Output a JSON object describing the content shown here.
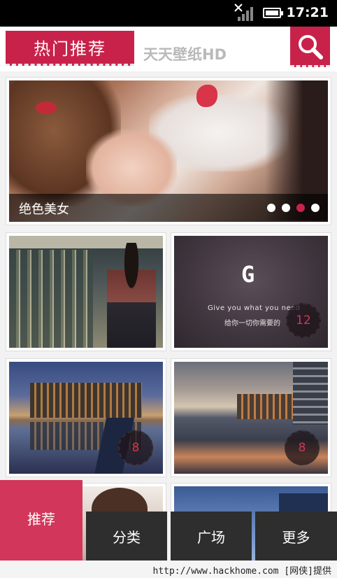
{
  "status_bar": {
    "time": "17:21",
    "icons": [
      "no-signal-icon",
      "battery-icon"
    ]
  },
  "header": {
    "tab_label": "热门推荐",
    "app_name": "天天壁纸HD",
    "search_icon": "search-icon",
    "accent_color": "#c8224a"
  },
  "banner": {
    "caption": "绝色美女",
    "page_count": 4,
    "active_page": 3
  },
  "tiles": [
    {
      "badge": ""
    },
    {
      "logo": "G",
      "tagline_en": "Give you what you need",
      "tagline_cn": "给你一切你需要的",
      "badge": "12"
    },
    {
      "badge": "8"
    },
    {
      "badge": "8"
    },
    {
      "badge": ""
    },
    {
      "badge": ""
    }
  ],
  "bottom_nav": {
    "items": [
      "推荐",
      "分类",
      "广场",
      "更多"
    ],
    "active_index": 0,
    "active_color": "#d2365a"
  },
  "watermark": "http://www.hackhome.com [网侠]提供"
}
